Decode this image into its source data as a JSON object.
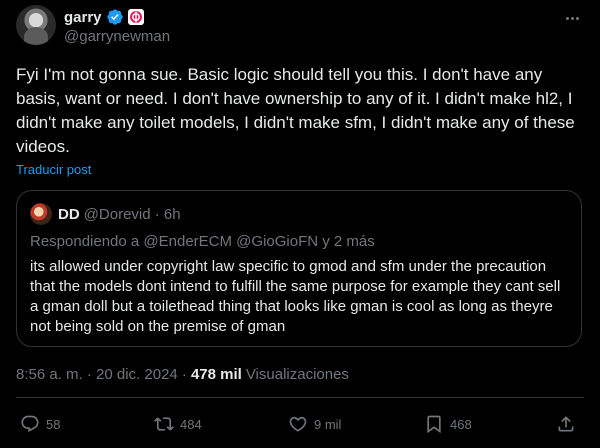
{
  "author": {
    "display_name": "garry",
    "handle": "@garrynewman"
  },
  "post": {
    "text": "Fyi I'm not gonna sue. Basic logic should tell you this. I don't have any basis, want or need. I don't have ownership to any of it. I didn't make hl2, I didn't make any toilet models, I didn't make sfm, I didn't make any of these videos.",
    "translate_label": "Traducir post"
  },
  "quote": {
    "display_name": "DD",
    "meta": "@Dorevid · 6h",
    "reply_context": "Respondiendo a @EnderECM @GioGioFN y 2 más",
    "text": "its allowed under copyright law specific to gmod and sfm under the precaution that the models dont intend to fulfill the same purpose for example they cant sell a gman doll but a toilethead thing that looks like gman is cool as long as theyre not being sold on the premise of gman"
  },
  "meta": {
    "timestamp": "8:56 a. m. · 20 dic. 2024 ·",
    "views_count": "478 mil",
    "views_label": "Visualizaciones"
  },
  "actions": {
    "replies": "58",
    "reposts": "484",
    "likes": "9 mil",
    "bookmarks": "468"
  },
  "colors": {
    "background": "#000000",
    "text": "#e7e9ea",
    "secondary": "#71767b",
    "accent": "#1d9bf0",
    "border": "#2f3336",
    "affiliate_badge": "#e0245e"
  },
  "icons": [
    "verified-badge-icon",
    "affiliate-badge-icon",
    "more-icon",
    "reply-icon",
    "repost-icon",
    "like-icon",
    "bookmark-icon",
    "share-icon"
  ]
}
